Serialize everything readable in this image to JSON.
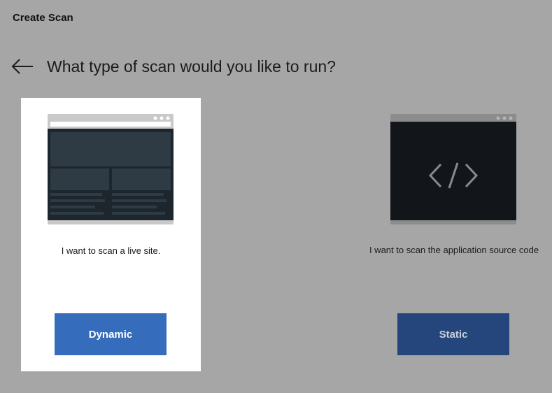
{
  "app": {
    "title": "Create Scan"
  },
  "header": {
    "heading": "What type of scan would you like to run?"
  },
  "options": [
    {
      "description": "I want to scan a live site.",
      "button_label": "Dynamic",
      "selected": true,
      "illustration": "webpage-window-icon"
    },
    {
      "description": "I want to scan the application source code",
      "button_label": "Static",
      "selected": false,
      "illustration": "code-window-icon"
    }
  ],
  "colors": {
    "background": "#a6a6a6",
    "selected_card": "#ffffff",
    "dynamic_button": "#356cbc",
    "static_button": "#25467c"
  }
}
